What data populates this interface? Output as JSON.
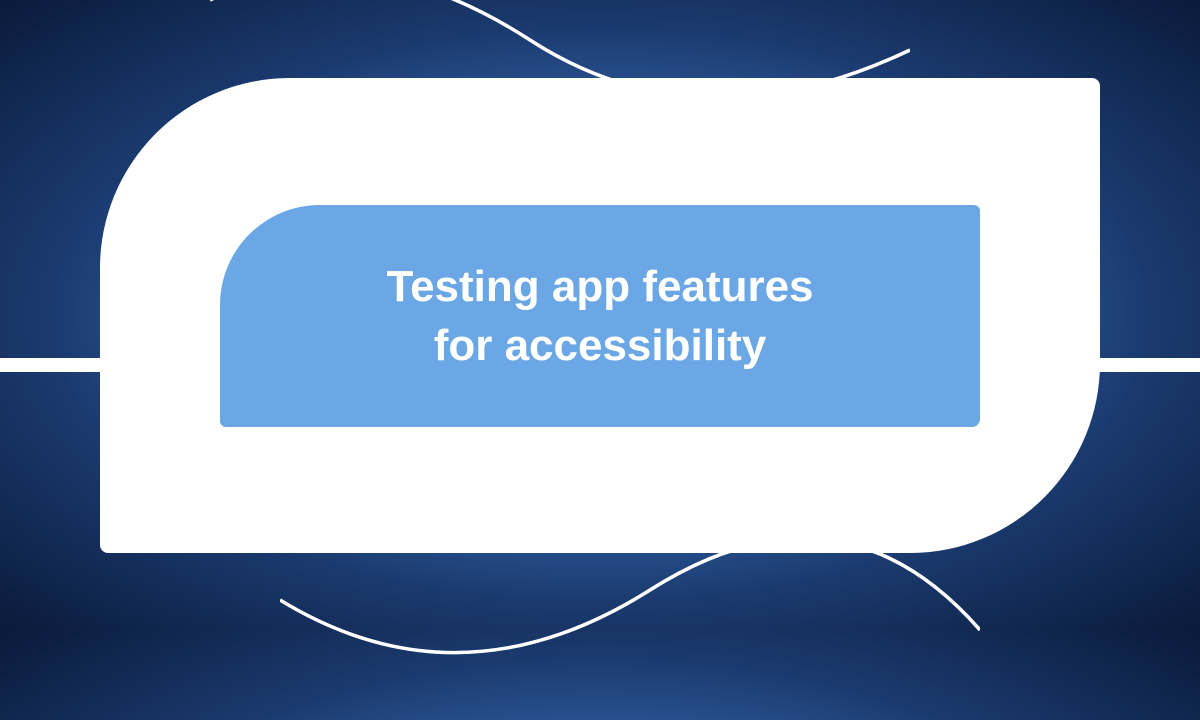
{
  "hero": {
    "title_line1": "Testing app features",
    "title_line2": "for accessibility"
  },
  "colors": {
    "bg_dark": "#0a1a3a",
    "bg_mid": "#3a6fb8",
    "bg_light": "#5a9be8",
    "shape_white": "#ffffff",
    "shape_blue": "#6ba7e5",
    "text": "#ffffff"
  }
}
